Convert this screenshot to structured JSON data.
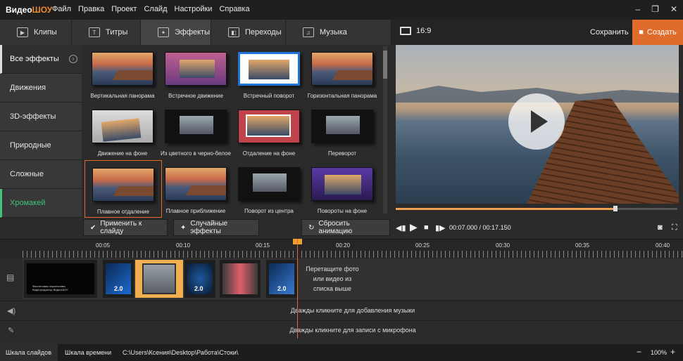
{
  "app": {
    "logo_a": "Видео",
    "logo_b": "ШОУ",
    "menu": [
      "Файл",
      "Правка",
      "Проект",
      "Слайд",
      "Настройки",
      "Справка"
    ]
  },
  "tabs": [
    {
      "label": "Клипы",
      "icon": "clip-icon"
    },
    {
      "label": "Титры",
      "icon": "text-icon"
    },
    {
      "label": "Эффекты",
      "icon": "magic-wand-icon"
    },
    {
      "label": "Переходы",
      "icon": "transitions-icon"
    },
    {
      "label": "Музыка",
      "icon": "music-icon"
    }
  ],
  "preview_header": {
    "ratio": "16:9",
    "save": "Сохранить",
    "create": "Создать"
  },
  "categories": [
    "Все эффекты",
    "Движения",
    "3D-эффекты",
    "Природные",
    "Сложные",
    "Хромакей"
  ],
  "effects": [
    "Вертикальная панорама",
    "Встречное движение",
    "Встречный поворот",
    "Горизонтальная панорама",
    "Движение на фоне",
    "Из цветного в черно-белое",
    "Отдаление на фоне",
    "Переворот",
    "Плавное отдаление",
    "Плавное приближение",
    "Поворот из центра",
    "Повороты на фоне"
  ],
  "actions": {
    "apply": "Применить к слайду",
    "random": "Случайные эффекты",
    "reset": "Сбросить анимацию"
  },
  "playback": {
    "timecode": "00:07.000 / 00:17.150",
    "progress": 0.78
  },
  "ruler": [
    "00:05",
    "00:10",
    "00:15",
    "00:20",
    "00:25",
    "00:30",
    "00:35",
    "00:40"
  ],
  "timeline": {
    "clip_text": "Фиолетовая перспектива\nВидеоредактор ВидеоШОУ",
    "durations": [
      "2.0",
      "2.0",
      "2.0"
    ],
    "hint": "Перетащите фото или видео из списка выше",
    "music_hint": "Дважды кликните для добавления музыки",
    "mic_hint": "Дважды кликните для записи с микрофона"
  },
  "bottom": {
    "slides_tab": "Шкала слайдов",
    "timeline_tab": "Шкала времени",
    "path": "C:\\Users\\Ксения\\Desktop\\Работа\\Стоки\\",
    "zoom": "100%"
  },
  "colors": {
    "accent": "#e06c2b",
    "chroma_green": "#3fc47a"
  }
}
